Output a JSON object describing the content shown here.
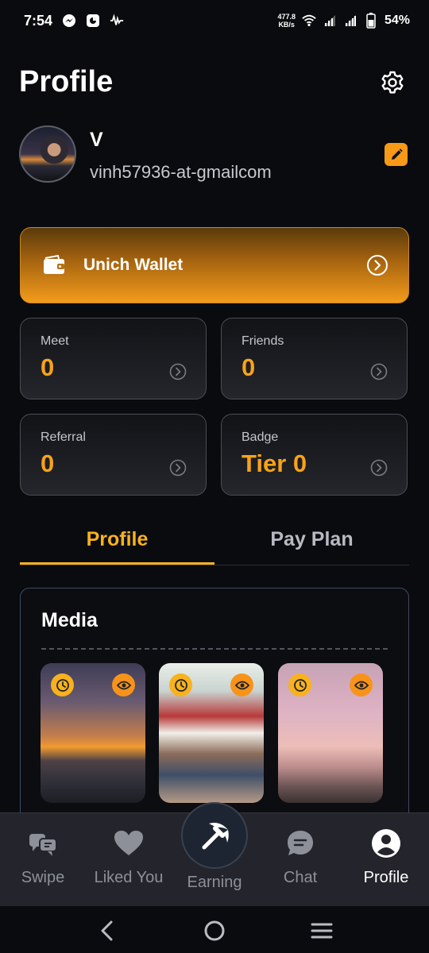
{
  "status_bar": {
    "time": "7:54",
    "network_speed_value": "477.8",
    "network_speed_unit": "KB/s",
    "battery": "54%",
    "icons": [
      "messenger-icon",
      "app-icon",
      "activity-icon",
      "wifi-icon",
      "signal-icon",
      "signal-icon",
      "battery-icon"
    ]
  },
  "header": {
    "title": "Profile",
    "settings_icon": "gear-icon"
  },
  "user": {
    "name": "V",
    "email": "vinh57936-at-gmailcom",
    "edit_icon": "pencil-icon"
  },
  "wallet": {
    "label": "Unich Wallet",
    "icon": "wallet-icon",
    "arrow_icon": "chevron-right-circle-icon"
  },
  "stats": [
    {
      "label": "Meet",
      "value": "0"
    },
    {
      "label": "Friends",
      "value": "0"
    },
    {
      "label": "Referral",
      "value": "0"
    },
    {
      "label": "Badge",
      "value": "Tier 0"
    }
  ],
  "tabs": [
    {
      "label": "Profile",
      "active": true
    },
    {
      "label": "Pay Plan",
      "active": false
    }
  ],
  "media": {
    "title": "Media",
    "items": 3
  },
  "bottom_nav": [
    {
      "label": "Swipe",
      "icon": "cards-icon"
    },
    {
      "label": "Liked You",
      "icon": "heart-icon"
    },
    {
      "label": "Earning",
      "icon": "pickaxe-icon"
    },
    {
      "label": "Chat",
      "icon": "chat-icon"
    },
    {
      "label": "Profile",
      "icon": "user-icon",
      "active": true
    }
  ],
  "colors": {
    "accent": "#f7a21a",
    "background": "#0a0b0e",
    "nav_background": "#24252c"
  }
}
